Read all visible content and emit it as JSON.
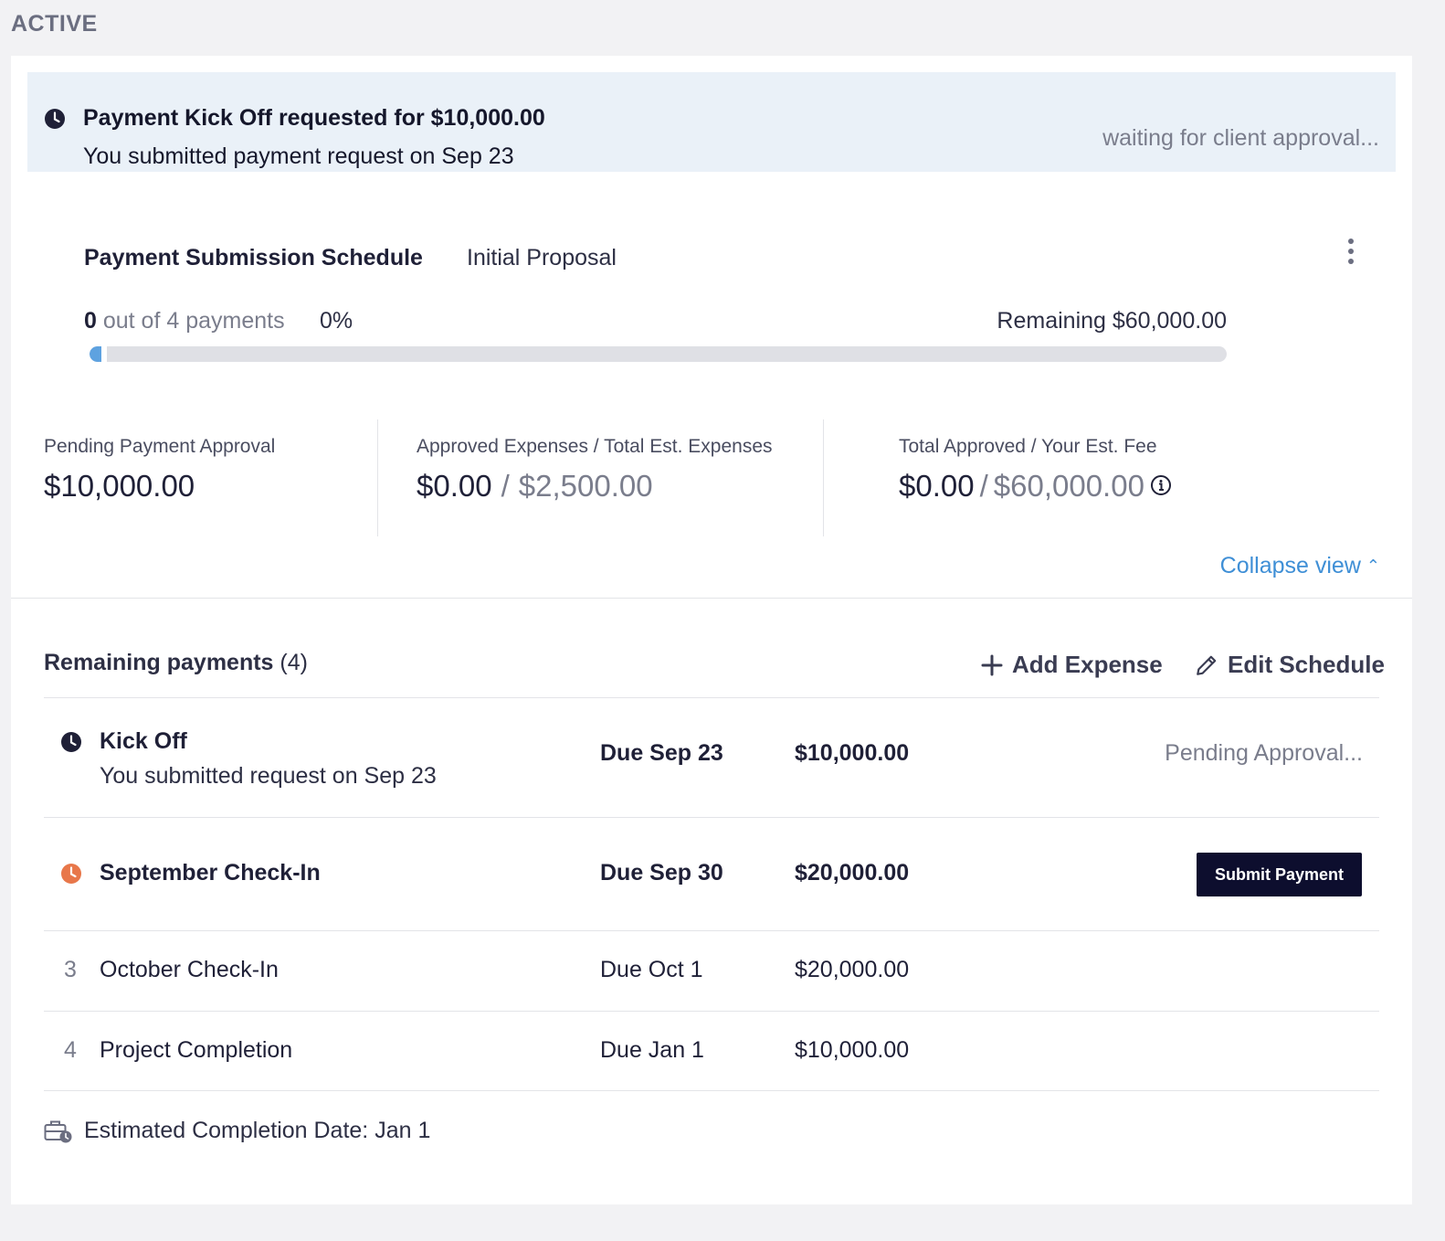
{
  "section_label": "ACTIVE",
  "alert": {
    "icon": "clock-icon",
    "title": "Payment Kick Off requested for $10,000.00",
    "subtitle": "You submitted payment request on Sep 23",
    "status": "waiting for client approval..."
  },
  "schedule": {
    "title": "Payment Submission Schedule",
    "proposal": "Initial Proposal",
    "menu_icon": "kebab-menu-icon",
    "progress": {
      "completed": "0",
      "of_text": " out of 4 payments",
      "percent": "0%",
      "fill_fraction": 0.0,
      "remaining": "Remaining $60,000.00"
    }
  },
  "stats": {
    "pending": {
      "label": "Pending Payment Approval",
      "value": "$10,000.00"
    },
    "expenses": {
      "label": "Approved Expenses / Total Est. Expenses",
      "approved": "$0.00",
      "separator": "/",
      "total": "$2,500.00"
    },
    "fee": {
      "label": "Total Approved / Your Est. Fee",
      "approved": "$0.00",
      "separator": "/",
      "total": "$60,000.00",
      "icon": "info-icon"
    }
  },
  "collapse_label": "Collapse view",
  "remaining_payments": {
    "title": "Remaining payments",
    "count": "(4)",
    "add_expense_label": "Add Expense",
    "edit_schedule_label": "Edit Schedule",
    "rows": [
      {
        "name": "Kick Off",
        "subtitle": "You submitted request on Sep 23",
        "due": "Due Sep 23",
        "amount": "$10,000.00",
        "status": "Pending Approval...",
        "icon": "clock-icon"
      },
      {
        "name": "September Check-In",
        "due": "Due Sep 30",
        "amount": "$20,000.00",
        "action": "Submit Payment",
        "icon": "clock-icon",
        "icon_color": "#e8774a"
      },
      {
        "number": "3",
        "name": "October Check-In",
        "due": "Due Oct 1",
        "amount": "$20,000.00"
      },
      {
        "number": "4",
        "name": "Project Completion",
        "due": "Due Jan 1",
        "amount": "$10,000.00"
      }
    ]
  },
  "footer": {
    "icon": "briefcase-clock-icon",
    "text": "Estimated Completion Date: Jan 1"
  },
  "colors": {
    "accent_blue": "#3f8fd6",
    "banner_bg": "#eaf1f8",
    "progress_fill": "#5ea2e0",
    "button_dark": "#0d0e2e",
    "warning_orange": "#e8774a"
  }
}
